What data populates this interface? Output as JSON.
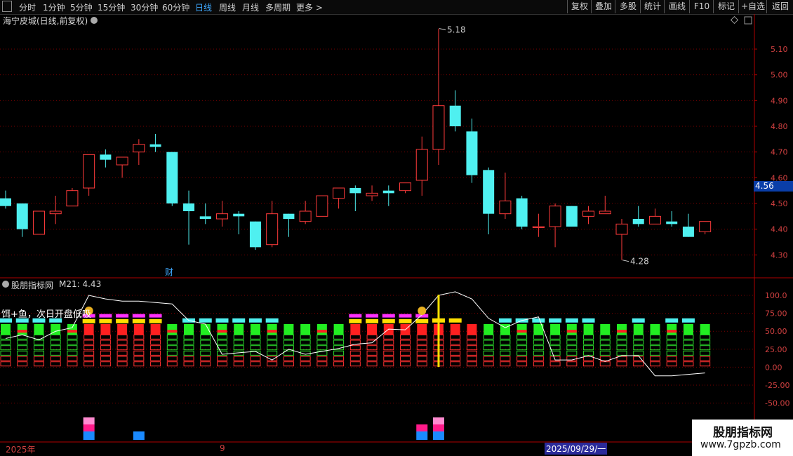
{
  "toolbar": {
    "periods": [
      "分时",
      "1分钟",
      "5分钟",
      "15分钟",
      "30分钟",
      "60分钟",
      "日线",
      "周线",
      "月线",
      "多周期",
      "更多 >"
    ],
    "active_period": "日线",
    "right_buttons": [
      "复权",
      "叠加",
      "多股",
      "统计",
      "画线",
      "F10",
      "标记",
      "+自选",
      "返回"
    ]
  },
  "chart": {
    "title": "海宁皮城(日线,前复权)",
    "price_labels": [
      "5.10",
      "5.00",
      "4.90",
      "4.80",
      "4.70",
      "4.60",
      "4.50",
      "4.40",
      "4.30"
    ],
    "current_price": "4.56",
    "high_label": "5.18",
    "low_label": "4.28",
    "event_label": "财"
  },
  "indicator": {
    "title": "股朋指标网",
    "value_text": "M21: 4.43",
    "strategy_text": "饵+鱼，次日开盘低吸",
    "axis_labels": [
      "100.0",
      "75.00",
      "50.00",
      "25.00",
      "0.00",
      "-25.00",
      "-50.00"
    ]
  },
  "timeaxis": {
    "year": "2025年",
    "month": "9",
    "date": "2025/09/29/一"
  },
  "watermark": {
    "line1": "股朋指标网",
    "line2": "www.7gpzb.com"
  },
  "colors": {
    "up": "#ff3b3b",
    "down": "#4ff0f0",
    "bg": "#000000",
    "grid": "#7a0000",
    "accent": "#3fa9ff",
    "highlight": "#ffe000"
  },
  "chart_data": {
    "type": "candlestick",
    "candles": [
      {
        "o": 4.49,
        "c": 4.52,
        "h": 4.55,
        "l": 4.48,
        "d": true
      },
      {
        "o": 4.5,
        "c": 4.4,
        "h": 4.5,
        "l": 4.37,
        "d": true
      },
      {
        "o": 4.38,
        "c": 4.47,
        "h": 4.47,
        "l": 4.38,
        "d": false
      },
      {
        "o": 4.46,
        "c": 4.47,
        "h": 4.53,
        "l": 4.42,
        "d": false
      },
      {
        "o": 4.49,
        "c": 4.55,
        "h": 4.56,
        "l": 4.49,
        "d": false
      },
      {
        "o": 4.56,
        "c": 4.69,
        "h": 4.69,
        "l": 4.53,
        "d": false
      },
      {
        "o": 4.69,
        "c": 4.67,
        "h": 4.71,
        "l": 4.64,
        "d": true
      },
      {
        "o": 4.65,
        "c": 4.68,
        "h": 4.68,
        "l": 4.6,
        "d": false
      },
      {
        "o": 4.7,
        "c": 4.73,
        "h": 4.75,
        "l": 4.65,
        "d": false
      },
      {
        "o": 4.73,
        "c": 4.72,
        "h": 4.77,
        "l": 4.7,
        "d": true
      },
      {
        "o": 4.7,
        "c": 4.5,
        "h": 4.7,
        "l": 4.49,
        "d": true
      },
      {
        "o": 4.5,
        "c": 4.47,
        "h": 4.55,
        "l": 4.34,
        "d": true
      },
      {
        "o": 4.45,
        "c": 4.44,
        "h": 4.5,
        "l": 4.42,
        "d": true
      },
      {
        "o": 4.44,
        "c": 4.46,
        "h": 4.51,
        "l": 4.41,
        "d": false
      },
      {
        "o": 4.46,
        "c": 4.45,
        "h": 4.47,
        "l": 4.38,
        "d": true
      },
      {
        "o": 4.43,
        "c": 4.33,
        "h": 4.43,
        "l": 4.32,
        "d": true
      },
      {
        "o": 4.34,
        "c": 4.46,
        "h": 4.51,
        "l": 4.33,
        "d": false
      },
      {
        "o": 4.46,
        "c": 4.44,
        "h": 4.46,
        "l": 4.37,
        "d": true
      },
      {
        "o": 4.43,
        "c": 4.47,
        "h": 4.51,
        "l": 4.42,
        "d": false
      },
      {
        "o": 4.45,
        "c": 4.53,
        "h": 4.53,
        "l": 4.45,
        "d": false
      },
      {
        "o": 4.52,
        "c": 4.56,
        "h": 4.56,
        "l": 4.48,
        "d": false
      },
      {
        "o": 4.56,
        "c": 4.54,
        "h": 4.57,
        "l": 4.47,
        "d": true
      },
      {
        "o": 4.53,
        "c": 4.54,
        "h": 4.57,
        "l": 4.51,
        "d": false
      },
      {
        "o": 4.55,
        "c": 4.54,
        "h": 4.57,
        "l": 4.49,
        "d": true
      },
      {
        "o": 4.55,
        "c": 4.58,
        "h": 4.58,
        "l": 4.54,
        "d": false
      },
      {
        "o": 4.59,
        "c": 4.71,
        "h": 4.76,
        "l": 4.53,
        "d": false
      },
      {
        "o": 4.71,
        "c": 4.88,
        "h": 5.18,
        "l": 4.65,
        "d": false
      },
      {
        "o": 4.88,
        "c": 4.8,
        "h": 4.94,
        "l": 4.78,
        "d": true
      },
      {
        "o": 4.78,
        "c": 4.61,
        "h": 4.83,
        "l": 4.58,
        "d": true
      },
      {
        "o": 4.63,
        "c": 4.46,
        "h": 4.64,
        "l": 4.38,
        "d": true
      },
      {
        "o": 4.46,
        "c": 4.51,
        "h": 4.62,
        "l": 4.44,
        "d": false
      },
      {
        "o": 4.52,
        "c": 4.41,
        "h": 4.53,
        "l": 4.4,
        "d": true
      },
      {
        "o": 4.41,
        "c": 4.41,
        "h": 4.46,
        "l": 4.37,
        "d": false
      },
      {
        "o": 4.41,
        "c": 4.49,
        "h": 4.5,
        "l": 4.33,
        "d": false
      },
      {
        "o": 4.49,
        "c": 4.41,
        "h": 4.49,
        "l": 4.41,
        "d": true
      },
      {
        "o": 4.45,
        "c": 4.47,
        "h": 4.49,
        "l": 4.42,
        "d": false
      },
      {
        "o": 4.46,
        "c": 4.47,
        "h": 4.53,
        "l": 4.46,
        "d": false
      },
      {
        "o": 4.38,
        "c": 4.42,
        "h": 4.44,
        "l": 4.28,
        "d": false
      },
      {
        "o": 4.44,
        "c": 4.42,
        "h": 4.49,
        "l": 4.41,
        "d": true
      },
      {
        "o": 4.42,
        "c": 4.45,
        "h": 4.48,
        "l": 4.42,
        "d": false
      },
      {
        "o": 4.43,
        "c": 4.42,
        "h": 4.47,
        "l": 4.41,
        "d": true
      },
      {
        "o": 4.41,
        "c": 4.37,
        "h": 4.46,
        "l": 4.37,
        "d": true
      },
      {
        "o": 4.39,
        "c": 4.43,
        "h": 4.43,
        "l": 4.38,
        "d": false
      }
    ],
    "indicator_line": [
      40,
      45,
      38,
      50,
      55,
      100,
      95,
      92,
      92,
      90,
      88,
      65,
      60,
      18,
      20,
      22,
      10,
      25,
      18,
      22,
      26,
      32,
      34,
      53,
      52,
      73,
      100,
      105,
      95,
      68,
      55,
      65,
      70,
      10,
      10,
      16,
      8,
      16,
      16,
      -12,
      -12,
      -10,
      -8,
      -14,
      5
    ],
    "signal_top": [
      "cyan",
      "cyan",
      "cyan",
      "cyan",
      "none",
      "mag",
      "mag",
      "mag",
      "mag",
      "mag",
      "none",
      "cyan",
      "cyan",
      "cyan",
      "cyan",
      "cyan",
      "cyan",
      "none",
      "none",
      "none",
      "none",
      "mag",
      "mag",
      "mag",
      "mag",
      "mag",
      "yellow",
      "yellow",
      "none",
      "none",
      "cyan",
      "cyan",
      "cyan",
      "cyan",
      "cyan",
      "cyan",
      "none",
      "none",
      "cyan",
      "none",
      "cyan",
      "cyan",
      "none"
    ],
    "bottom_blocks": [
      {
        "i": 5,
        "pink": true,
        "red": true,
        "blue": true
      },
      {
        "i": 8,
        "pink": false,
        "red": false,
        "blue": true
      },
      {
        "i": 25,
        "pink": false,
        "red": true,
        "blue": true
      },
      {
        "i": 26,
        "pink": true,
        "red": true,
        "blue": true
      }
    ],
    "ylim_price": [
      4.25,
      5.2
    ],
    "ylim_indicator": [
      -60,
      105
    ]
  }
}
